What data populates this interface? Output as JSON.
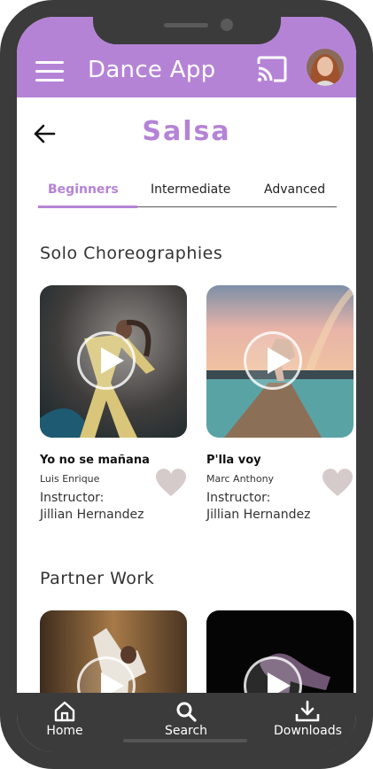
{
  "app": {
    "title": "Dance App",
    "accent_color": "#b583d6",
    "header_icons": [
      "menu-icon",
      "cast-icon",
      "avatar"
    ]
  },
  "page": {
    "title": "Salsa",
    "back_icon": "arrow-left-icon"
  },
  "tabs": [
    {
      "label": "Beginners",
      "active": true
    },
    {
      "label": "Intermediate",
      "active": false
    },
    {
      "label": "Advanced",
      "active": false
    }
  ],
  "sections": [
    {
      "title": "Solo Choreographies",
      "cards": [
        {
          "song": "Yo no se mañana",
          "artist": "Luis Enrique",
          "instructor_label": "Instructor:",
          "instructor": "Jillian Hernandez",
          "favorite_icon": "heart-icon"
        },
        {
          "song": "P'lla voy",
          "artist": "Marc Anthony",
          "instructor_label": "Instructor:",
          "instructor": "Jillian Hernandez",
          "favorite_icon": "heart-icon"
        }
      ]
    },
    {
      "title": "Partner Work",
      "cards": [
        {
          "favorite_icon": "heart-icon"
        },
        {
          "favorite_icon": "heart-icon"
        }
      ]
    }
  ],
  "bottom_nav": [
    {
      "label": "Home",
      "icon": "home-icon"
    },
    {
      "label": "Search",
      "icon": "search-icon"
    },
    {
      "label": "Downloads",
      "icon": "download-icon"
    }
  ]
}
